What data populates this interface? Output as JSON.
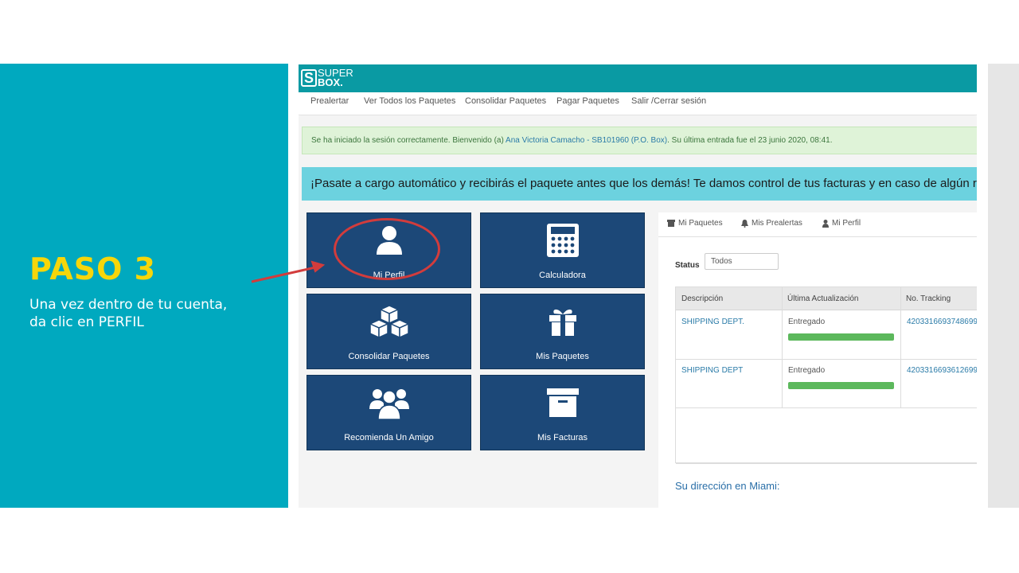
{
  "slide": {
    "step_title": "PASO 3",
    "step_desc_line1": "Una vez dentro de tu cuenta,",
    "step_desc_line2": "da clic en PERFIL",
    "accent_color": "#00a9bf",
    "title_color": "#f6d60a",
    "annotation_color": "#d23c3c"
  },
  "app": {
    "logo_top": "SUPER",
    "logo_bottom": "BOX.",
    "logo_letter": "S",
    "nav": [
      "Prealertar",
      "Ver Todos los Paquetes",
      "Consolidar Paquetes",
      "Pagar Paquetes",
      "Salir /Cerrar sesión"
    ],
    "alert": {
      "prefix": "Se ha iniciado la sesión correctamente. Bienvenido (a) ",
      "user": "Ana Victoria Camacho - SB101960 (P.O. Box)",
      "suffix": ". Su última entrada fue el 23 junio 2020, 08:41."
    },
    "promo": "¡Pasate a cargo automático y recibirás el paquete antes que los demás! Te damos control de tus facturas y en caso de algún reclamo",
    "tiles": [
      {
        "label": "Mi Perfil",
        "icon": "user-icon"
      },
      {
        "label": "Calculadora",
        "icon": "calculator-icon"
      },
      {
        "label": "Consolidar Paquetes",
        "icon": "boxes-icon"
      },
      {
        "label": "Mis Paquetes",
        "icon": "gift-icon"
      },
      {
        "label": "Recomienda Un Amigo",
        "icon": "group-icon"
      },
      {
        "label": "Mis Facturas",
        "icon": "archive-icon"
      }
    ],
    "tabs": [
      "Mi Paquetes",
      "Mis Prealertas",
      "Mi Perfil"
    ],
    "status": {
      "label": "Status",
      "value": "Todos"
    },
    "table": {
      "headers": [
        "Descripción",
        "Última Actualización",
        "No. Tracking"
      ],
      "rows": [
        {
          "desc": "SHIPPING DEPT.",
          "status": "Entregado",
          "progress": 1.0,
          "tracking": "4203316693748699"
        },
        {
          "desc": "SHIPPING DEPT",
          "status": "Entregado",
          "progress": 1.0,
          "tracking": "4203316693612699"
        }
      ]
    },
    "address_heading": "Su dirección en Miami:"
  }
}
